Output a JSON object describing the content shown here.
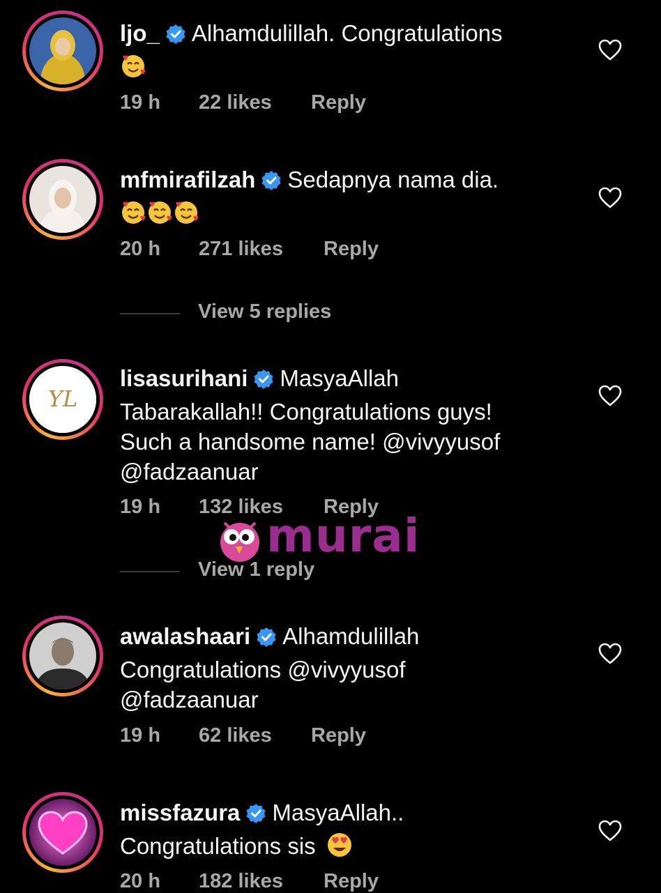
{
  "comments": [
    {
      "username": "ljo_",
      "text": "Alhamdulillah. Congratulations",
      "emoji_count": 1,
      "time": "19 h",
      "likes": "22 likes",
      "reply": "Reply"
    },
    {
      "username": "mfmirafilzah",
      "text": "Sedapnya nama dia.",
      "emoji_count": 3,
      "time": "20 h",
      "likes": "271 likes",
      "reply": "Reply",
      "view_replies": "View 5 replies"
    },
    {
      "username": "lisasurihani",
      "text_lines": [
        "MasyaAllah",
        "Tabarakallah!! Congratulations guys!",
        "Such a handsome name! @vivyyusof",
        "@fadzaanuar"
      ],
      "avatar_monogram": "YL",
      "time": "19 h",
      "likes": "132 likes",
      "reply": "Reply",
      "view_replies": "View 1 reply"
    },
    {
      "username": "awalashaari",
      "text_lines": [
        "Alhamdulillah",
        "Congratulations @vivyyusof",
        "@fadzaanuar"
      ],
      "time": "19 h",
      "likes": "62 likes",
      "reply": "Reply"
    },
    {
      "username": "missfazura",
      "text_lines": [
        "MasyaAllah..",
        "Congratulations sis"
      ],
      "time": "20 h",
      "likes": "182 likes",
      "reply": "Reply"
    }
  ],
  "watermark": {
    "brand": "murai"
  },
  "colors": {
    "background": "#000000",
    "verified": "#3897f0",
    "meta_text": "#a8a8a8",
    "watermark": "#9b2d8f"
  }
}
